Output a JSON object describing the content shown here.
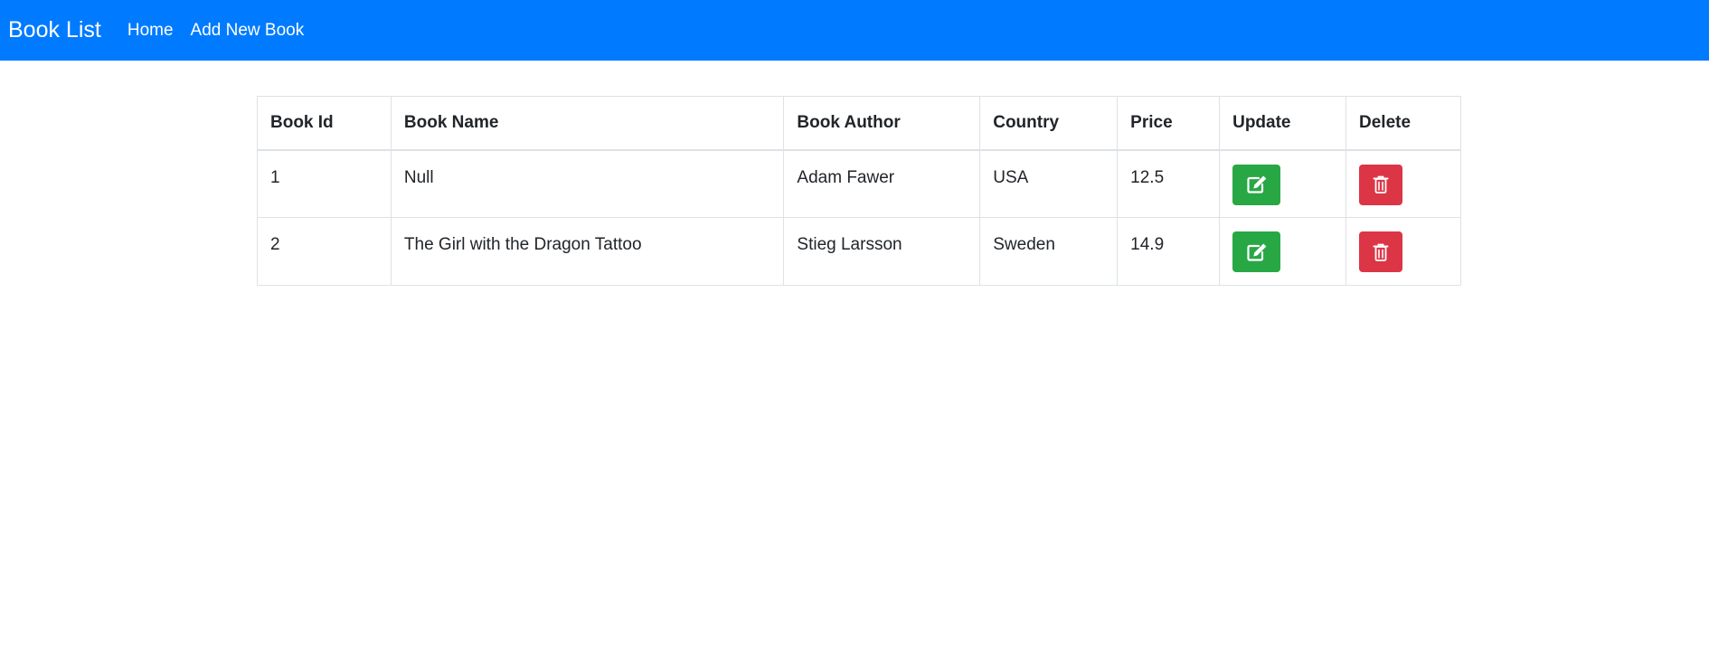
{
  "navbar": {
    "brand": "Book List",
    "links": [
      "Home",
      "Add New Book"
    ],
    "color": "#007bff"
  },
  "table": {
    "headers": [
      "Book Id",
      "Book Name",
      "Book Author",
      "Country",
      "Price",
      "Update",
      "Delete"
    ],
    "rows": [
      {
        "id": "1",
        "name": "Null",
        "author": "Adam Fawer",
        "country": "USA",
        "price": "12.5"
      },
      {
        "id": "2",
        "name": "The Girl with the Dragon Tattoo",
        "author": "Stieg Larsson",
        "country": "Sweden",
        "price": "14.9"
      }
    ],
    "update_icon": "edit-icon",
    "delete_icon": "trash-icon",
    "update_color": "#28a745",
    "delete_color": "#dc3545"
  }
}
